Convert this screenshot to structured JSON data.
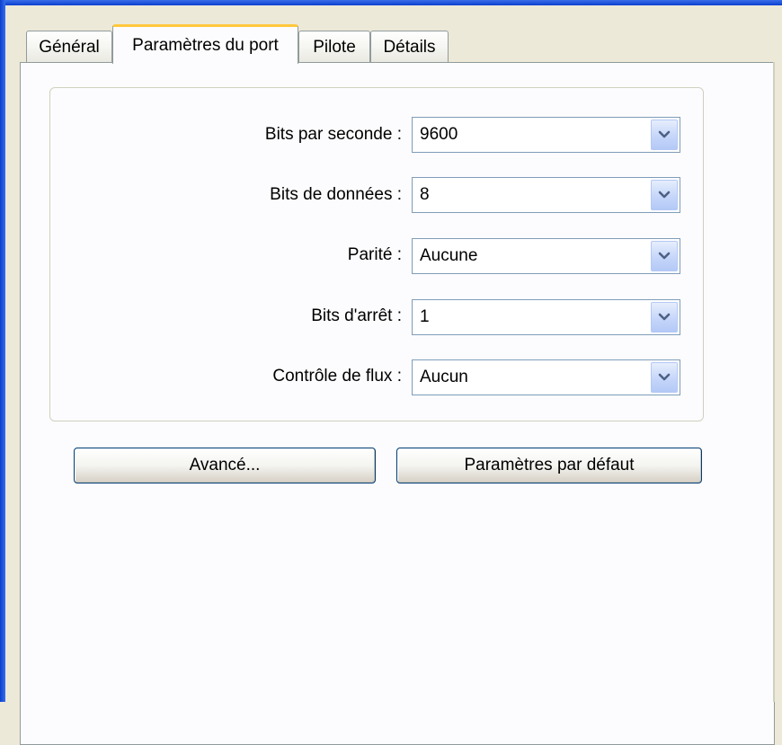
{
  "tabs": [
    {
      "label": "Général",
      "active": false
    },
    {
      "label": "Paramètres du port",
      "active": true
    },
    {
      "label": "Pilote",
      "active": false
    },
    {
      "label": "Détails",
      "active": false
    }
  ],
  "fields": [
    {
      "label": "Bits par seconde :",
      "value": "9600"
    },
    {
      "label": "Bits de données :",
      "value": "8"
    },
    {
      "label": "Parité :",
      "value": "Aucune"
    },
    {
      "label": "Bits d'arrêt :",
      "value": "1"
    },
    {
      "label": "Contrôle de flux :",
      "value": "Aucun"
    }
  ],
  "buttons": {
    "advanced": "Avancé...",
    "defaults": "Paramètres par défaut"
  },
  "icons": {
    "combo_arrow": "chevron-down-icon"
  },
  "colors": {
    "window_frame": "#0A3FD0",
    "dialog_bg": "#ECE9D8",
    "tab_highlight": "#FFC83C",
    "combo_border": "#7F9DB9",
    "arrow_color": "#4D6185"
  }
}
